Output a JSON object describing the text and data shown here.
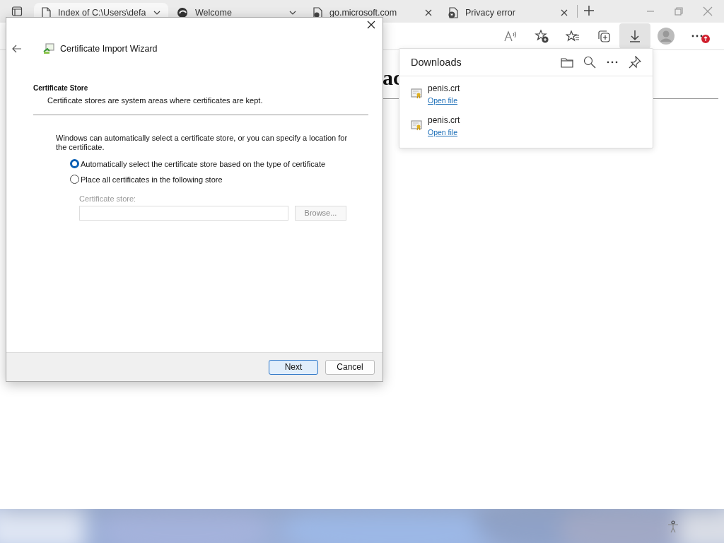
{
  "browser": {
    "tabs": [
      {
        "title": "Index of C:\\Users\\defa",
        "selected": true,
        "kind": "menu"
      },
      {
        "title": "Welcome",
        "selected": false,
        "kind": "menu"
      },
      {
        "title": "go.microsoft.com",
        "selected": false,
        "kind": "close"
      },
      {
        "title": "Privacy error",
        "selected": false,
        "kind": "close"
      }
    ]
  },
  "page": {
    "heading_fragment": "ac"
  },
  "downloads": {
    "title": "Downloads",
    "items": [
      {
        "file": "penis.crt",
        "action": "Open file"
      },
      {
        "file": "penis.crt",
        "action": "Open file"
      }
    ]
  },
  "dialog": {
    "title": "Certificate Import Wizard",
    "section_title": "Certificate Store",
    "section_description": "Certificate stores are system areas where certificates are kept.",
    "intro": "Windows can automatically select a certificate store, or you can specify a location for the certificate.",
    "options": [
      {
        "label": "Automatically select the certificate store based on the type of certificate",
        "selected": true
      },
      {
        "label": "Place all certificates in the following store",
        "selected": false
      }
    ],
    "store": {
      "label": "Certificate store:",
      "button": "Browse...",
      "disabled": true
    },
    "buttons": [
      {
        "label": "Next",
        "kind": "primary"
      },
      {
        "label": "Cancel",
        "kind": "secondary"
      }
    ]
  }
}
